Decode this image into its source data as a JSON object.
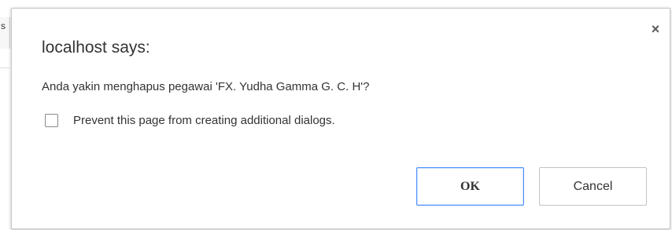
{
  "background": {
    "left_fragment": "s"
  },
  "dialog": {
    "title": "localhost says:",
    "message": "Anda yakin menghapus pegawai 'FX. Yudha Gamma G. C. H'?",
    "close_glyph": "×",
    "checkbox": {
      "label": "Prevent this page from creating additional dialogs.",
      "checked": false
    },
    "buttons": {
      "ok_label": "OK",
      "cancel_label": "Cancel"
    },
    "colors": {
      "ok_border": "#4d90fe",
      "text": "#333333"
    }
  }
}
